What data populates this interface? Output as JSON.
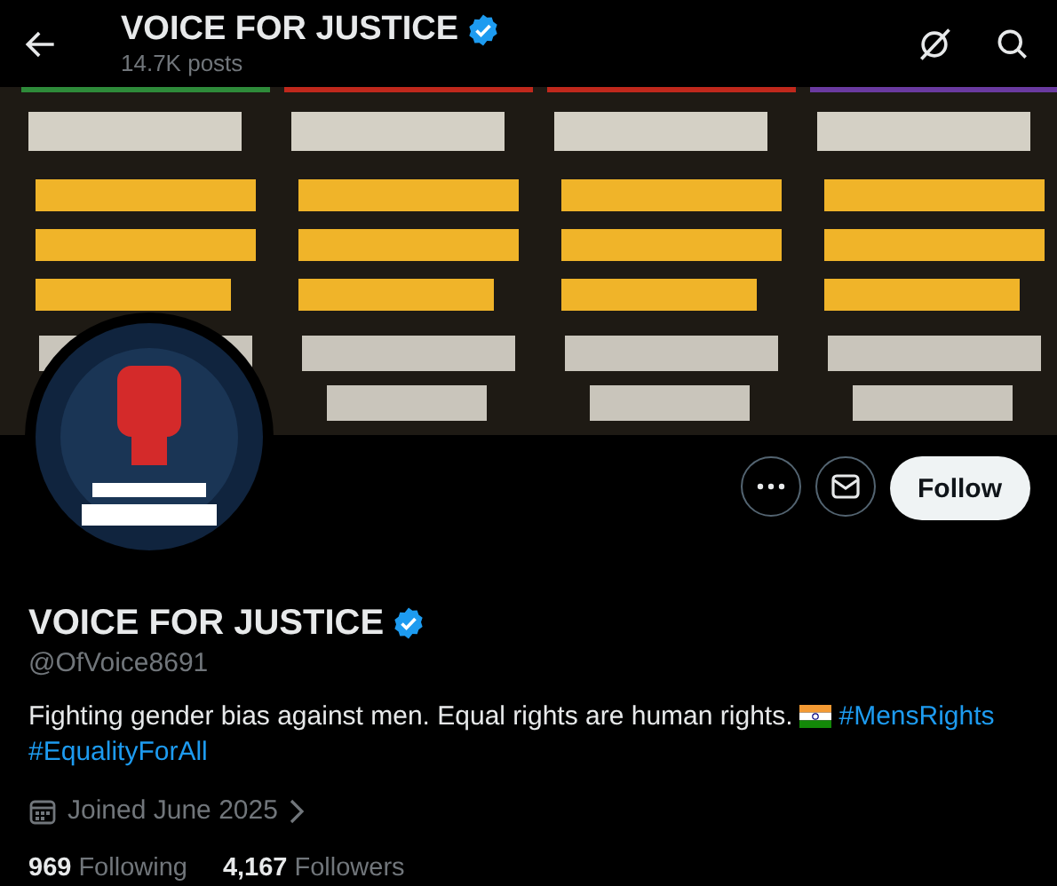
{
  "header": {
    "title": "VOICE FOR JUSTICE",
    "verified": true,
    "posts": "14.7K posts"
  },
  "actions": {
    "follow": "Follow"
  },
  "profile": {
    "name": "VOICE FOR JUSTICE",
    "verified": true,
    "handle": "@OfVoice8691",
    "bio": "Fighting gender bias against men. Equal rights are human rights.",
    "hashtags": [
      "#MensRights",
      "#EqualityForAll"
    ],
    "joined": "Joined June 2025"
  },
  "stats": [
    {
      "count": "969",
      "label": "Following"
    },
    {
      "count": "4,167",
      "label": "Followers"
    }
  ]
}
